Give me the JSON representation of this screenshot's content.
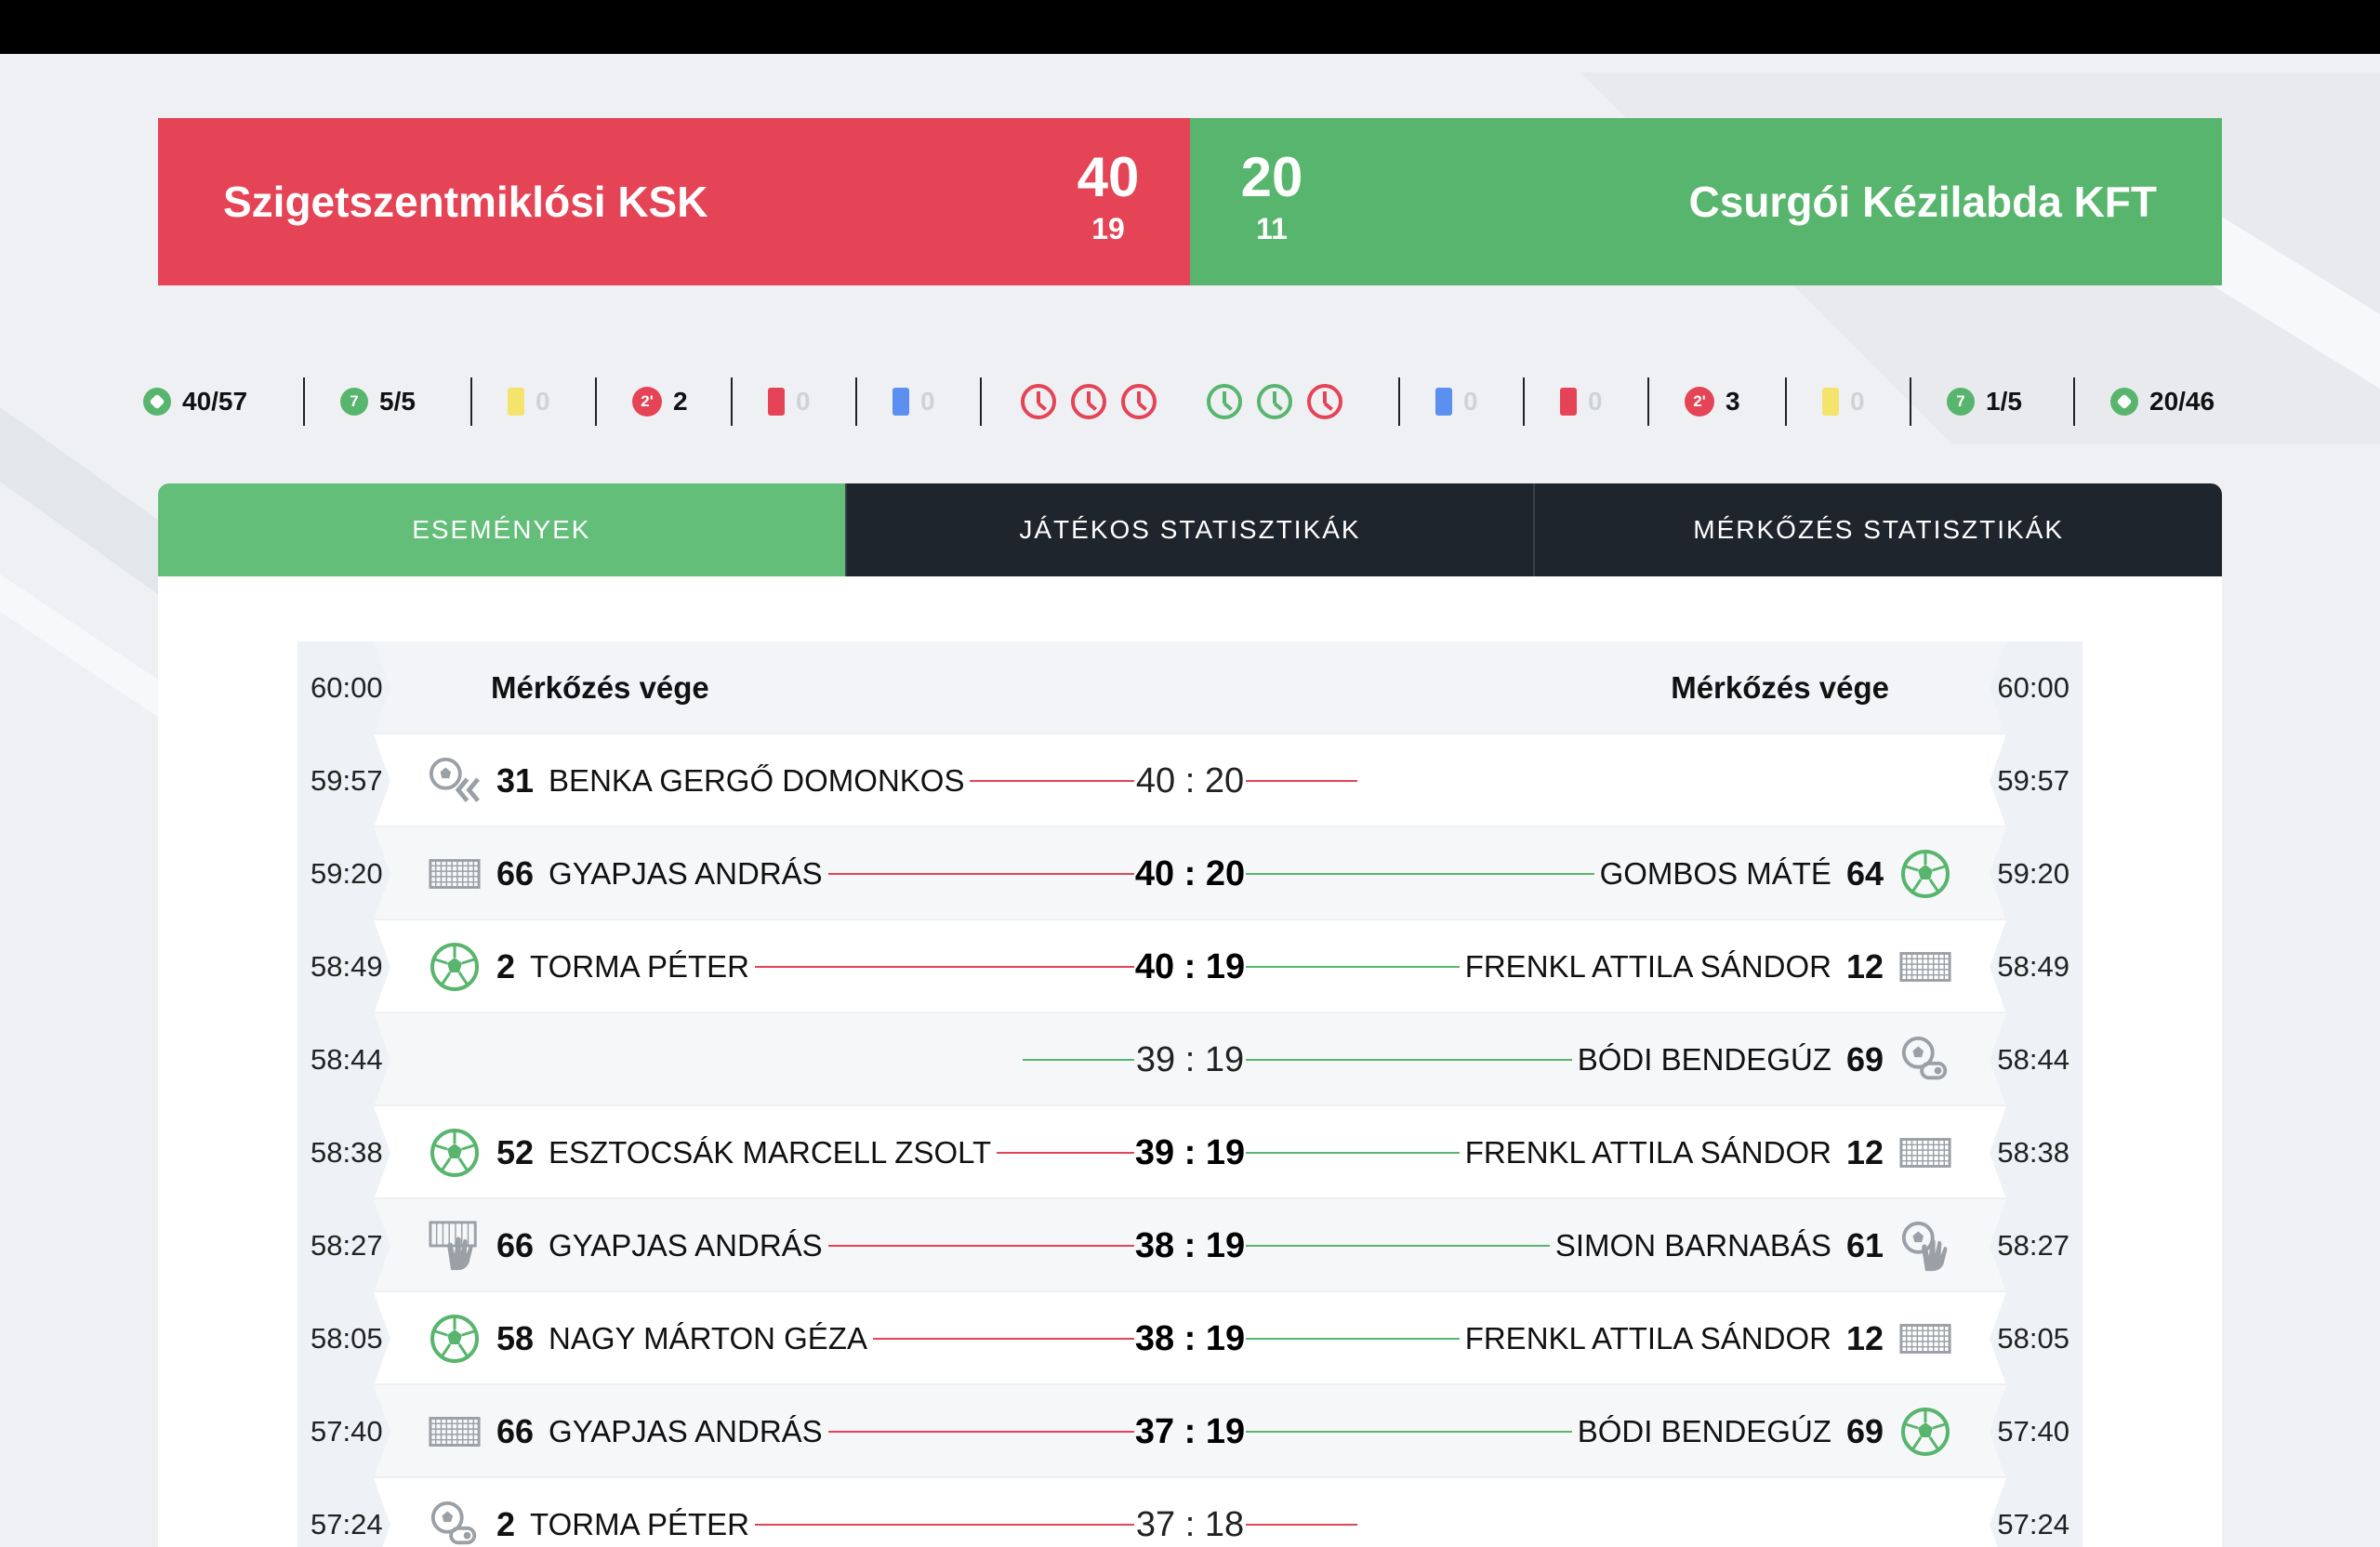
{
  "colors": {
    "home": "#e44456",
    "away": "#58b56d",
    "tab_dark": "#1f252c"
  },
  "home": {
    "name": "Szigetszentmiklósi KSK",
    "score": "40",
    "half": "19"
  },
  "away": {
    "name": "Csurgói Kézilabda KFT",
    "score": "20",
    "half": "11"
  },
  "stats": {
    "home": {
      "goals": "40/57",
      "sevens": "5/5",
      "yellow": "0",
      "twomin": "2",
      "red": "0",
      "blue": "0"
    },
    "away": {
      "goals": "20/46",
      "sevens": "1/5",
      "yellow": "0",
      "twomin": "3",
      "red": "0",
      "blue": "0"
    }
  },
  "tabs": [
    "ESEMÉNYEK",
    "JÁTÉKOS STATISZTIKÁK",
    "MÉRKŐZÉS STATISZTIKÁK"
  ],
  "header_row": {
    "time": "60:00",
    "left": "Mérkőzés vége",
    "right": "Mérkőzés vége"
  },
  "events": [
    {
      "time": "59:57",
      "score": "40 : 20",
      "left": {
        "num": "31",
        "name": "Benka Gergő Domonkos",
        "icon": "ball-save-icon"
      },
      "right": null
    },
    {
      "time": "59:20",
      "score": "40 : 20",
      "left": {
        "num": "66",
        "name": "Gyapjas András",
        "icon": "goal-net-icon"
      },
      "right": {
        "num": "64",
        "name": "Gombos Máté",
        "icon": "goal-ball-icon"
      }
    },
    {
      "time": "58:49",
      "score": "40 : 19",
      "left": {
        "num": "2",
        "name": "Torma Péter",
        "icon": "goal-ball-icon"
      },
      "right": {
        "num": "12",
        "name": "Frenkl Attila Sándor",
        "icon": "goal-net-icon"
      }
    },
    {
      "time": "58:44",
      "score": "39 : 19",
      "left": null,
      "right": {
        "num": "69",
        "name": "Bódi Bendegúz",
        "icon": "whistle-ball-icon"
      }
    },
    {
      "time": "58:38",
      "score": "39 : 19",
      "left": {
        "num": "52",
        "name": "Esztocsák Marcell Zsolt",
        "icon": "goal-ball-icon"
      },
      "right": {
        "num": "12",
        "name": "Frenkl Attila Sándor",
        "icon": "goal-net-icon"
      }
    },
    {
      "time": "58:27",
      "score": "38 : 19",
      "left": {
        "num": "66",
        "name": "Gyapjas András",
        "icon": "goalkeeper-save-icon"
      },
      "right": {
        "num": "61",
        "name": "Simon Barnabás",
        "icon": "hand-ball-icon"
      }
    },
    {
      "time": "58:05",
      "score": "38 : 19",
      "left": {
        "num": "58",
        "name": "Nagy Márton Géza",
        "icon": "goal-ball-icon"
      },
      "right": {
        "num": "12",
        "name": "Frenkl Attila Sándor",
        "icon": "goal-net-icon"
      }
    },
    {
      "time": "57:40",
      "score": "37 : 19",
      "left": {
        "num": "66",
        "name": "Gyapjas András",
        "icon": "goal-net-icon"
      },
      "right": {
        "num": "69",
        "name": "Bódi Bendegúz",
        "icon": "goal-ball-icon"
      }
    },
    {
      "time": "57:24",
      "score": "37 : 18",
      "left": {
        "num": "2",
        "name": "Torma Péter",
        "icon": "whistle-ball-icon"
      },
      "right": null
    }
  ]
}
